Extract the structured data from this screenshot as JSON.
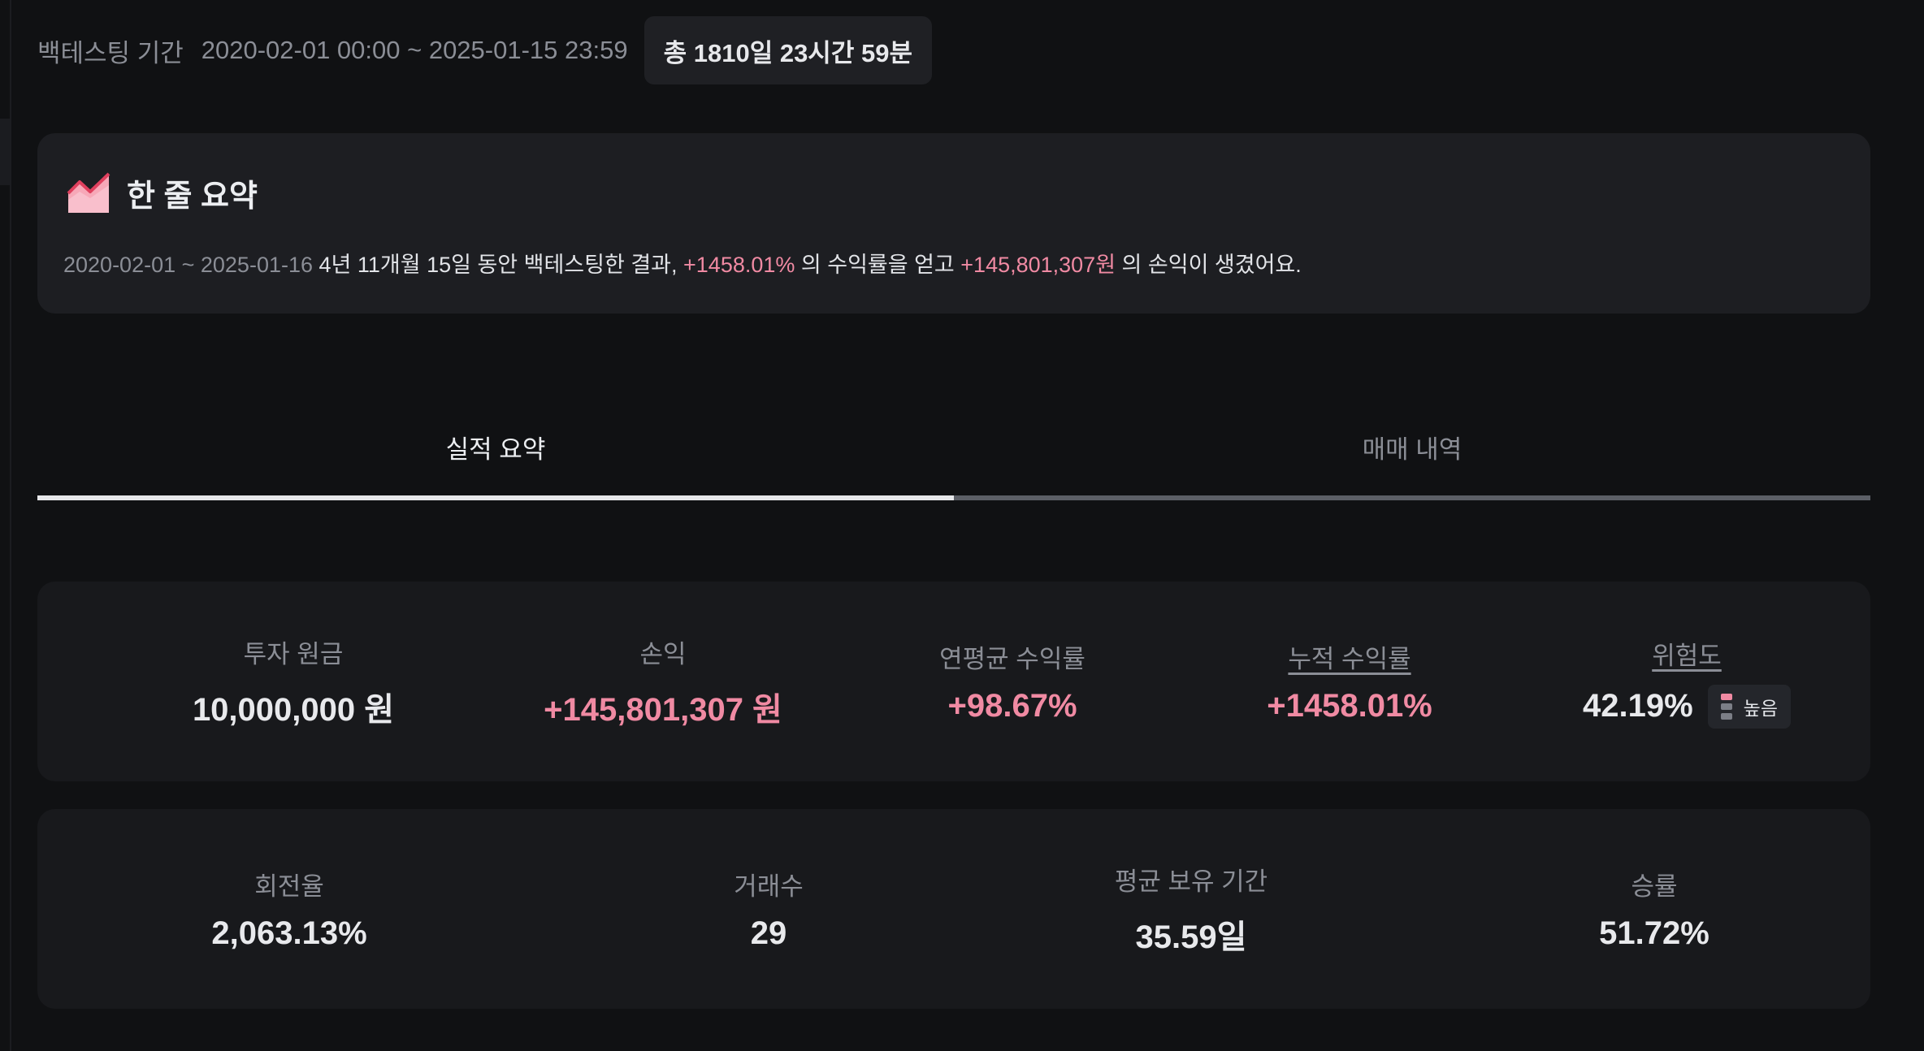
{
  "period": {
    "label": "백테스팅 기간",
    "range": "2020-02-01 00:00 ~ 2025-01-15 23:59",
    "total": "총 1810일 23시간 59분"
  },
  "summary": {
    "icon": "area-chart-icon",
    "title": "한 줄 요약",
    "date_range": "2020-02-01 ~ 2025-01-16",
    "text_1": " 4년 11개월 15일 동안 백테스팅한 결과, ",
    "return_rate": "+1458.01%",
    "text_2": " 의 수익률을 얻고 ",
    "profit": "+145,801,307원",
    "text_3": " 의 손익이 생겼어요."
  },
  "tabs": [
    {
      "label": "실적 요약",
      "active": true
    },
    {
      "label": "매매 내역",
      "active": false
    }
  ],
  "metrics_primary": [
    {
      "label": "투자 원금",
      "value": "10,000,000 원"
    },
    {
      "label": "손익",
      "value": "+145,801,307 원"
    },
    {
      "label": "연평균 수익률",
      "value": "+98.67%"
    },
    {
      "label": "누적 수익률",
      "value": "+1458.01%"
    },
    {
      "label": "위험도",
      "value": "42.19%",
      "badge": "높음"
    }
  ],
  "metrics_secondary": [
    {
      "label": "회전율",
      "value": "2,063.13%"
    },
    {
      "label": "거래수",
      "value": "29"
    },
    {
      "label": "평균 보유 기간",
      "value": "35.59일"
    },
    {
      "label": "승률",
      "value": "51.72%"
    }
  ],
  "colors": {
    "background": "#101113",
    "card": "#1d1e22",
    "positive": "#f08aa3",
    "muted": "#8b8e96"
  }
}
